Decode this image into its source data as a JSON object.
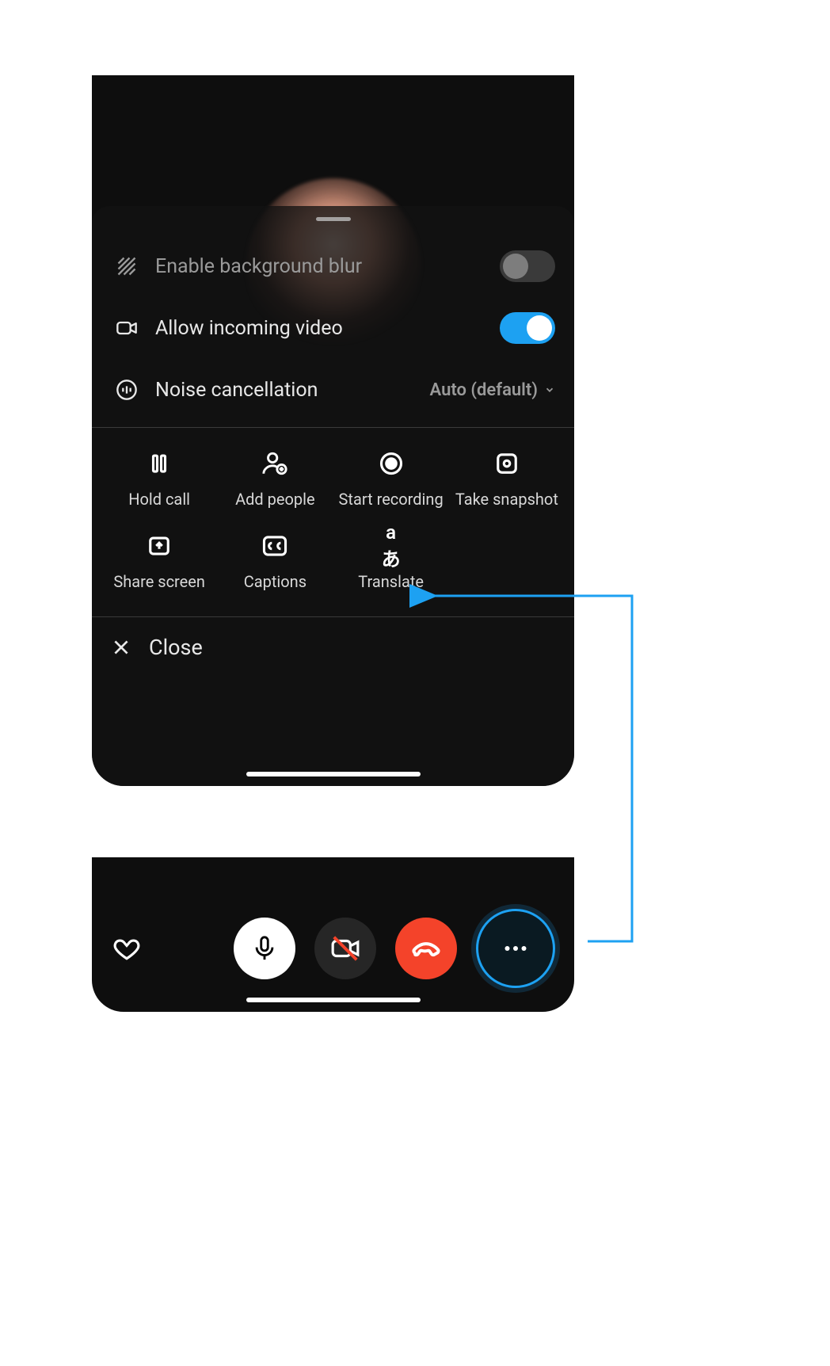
{
  "settings": {
    "bg_blur": {
      "label": "Enable background blur",
      "on": false
    },
    "incoming": {
      "label": "Allow incoming video",
      "on": true
    },
    "noise": {
      "label": "Noise cancellation",
      "value": "Auto (default)"
    }
  },
  "actions": {
    "hold": "Hold call",
    "add": "Add people",
    "record": "Start recording",
    "snapshot": "Take snapshot",
    "share": "Share screen",
    "captions": "Captions",
    "translate": "Translate"
  },
  "close_label": "Close",
  "colors": {
    "accent": "#1da1f2",
    "end_call": "#f4432a"
  }
}
